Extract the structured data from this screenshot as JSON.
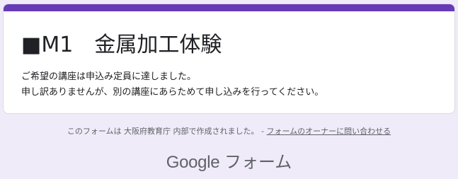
{
  "form": {
    "title": "■M1　金属加工体験",
    "message_line1": "ご希望の講座は申込み定員に達しました。",
    "message_line2": "申し訳ありませんが、別の講座にあらためて申し込みを行ってください。"
  },
  "footer": {
    "notice": "このフォームは 大阪府教育庁 内部で作成されました。 - ",
    "contact_link": "フォームのオーナーに問い合わせる"
  },
  "brand": {
    "google": "Google",
    "forms": " フォーム"
  },
  "colors": {
    "accent": "#673ab7",
    "background": "#f0ebf8",
    "card": "#ffffff",
    "text": "#202124",
    "muted": "#5f6368"
  }
}
